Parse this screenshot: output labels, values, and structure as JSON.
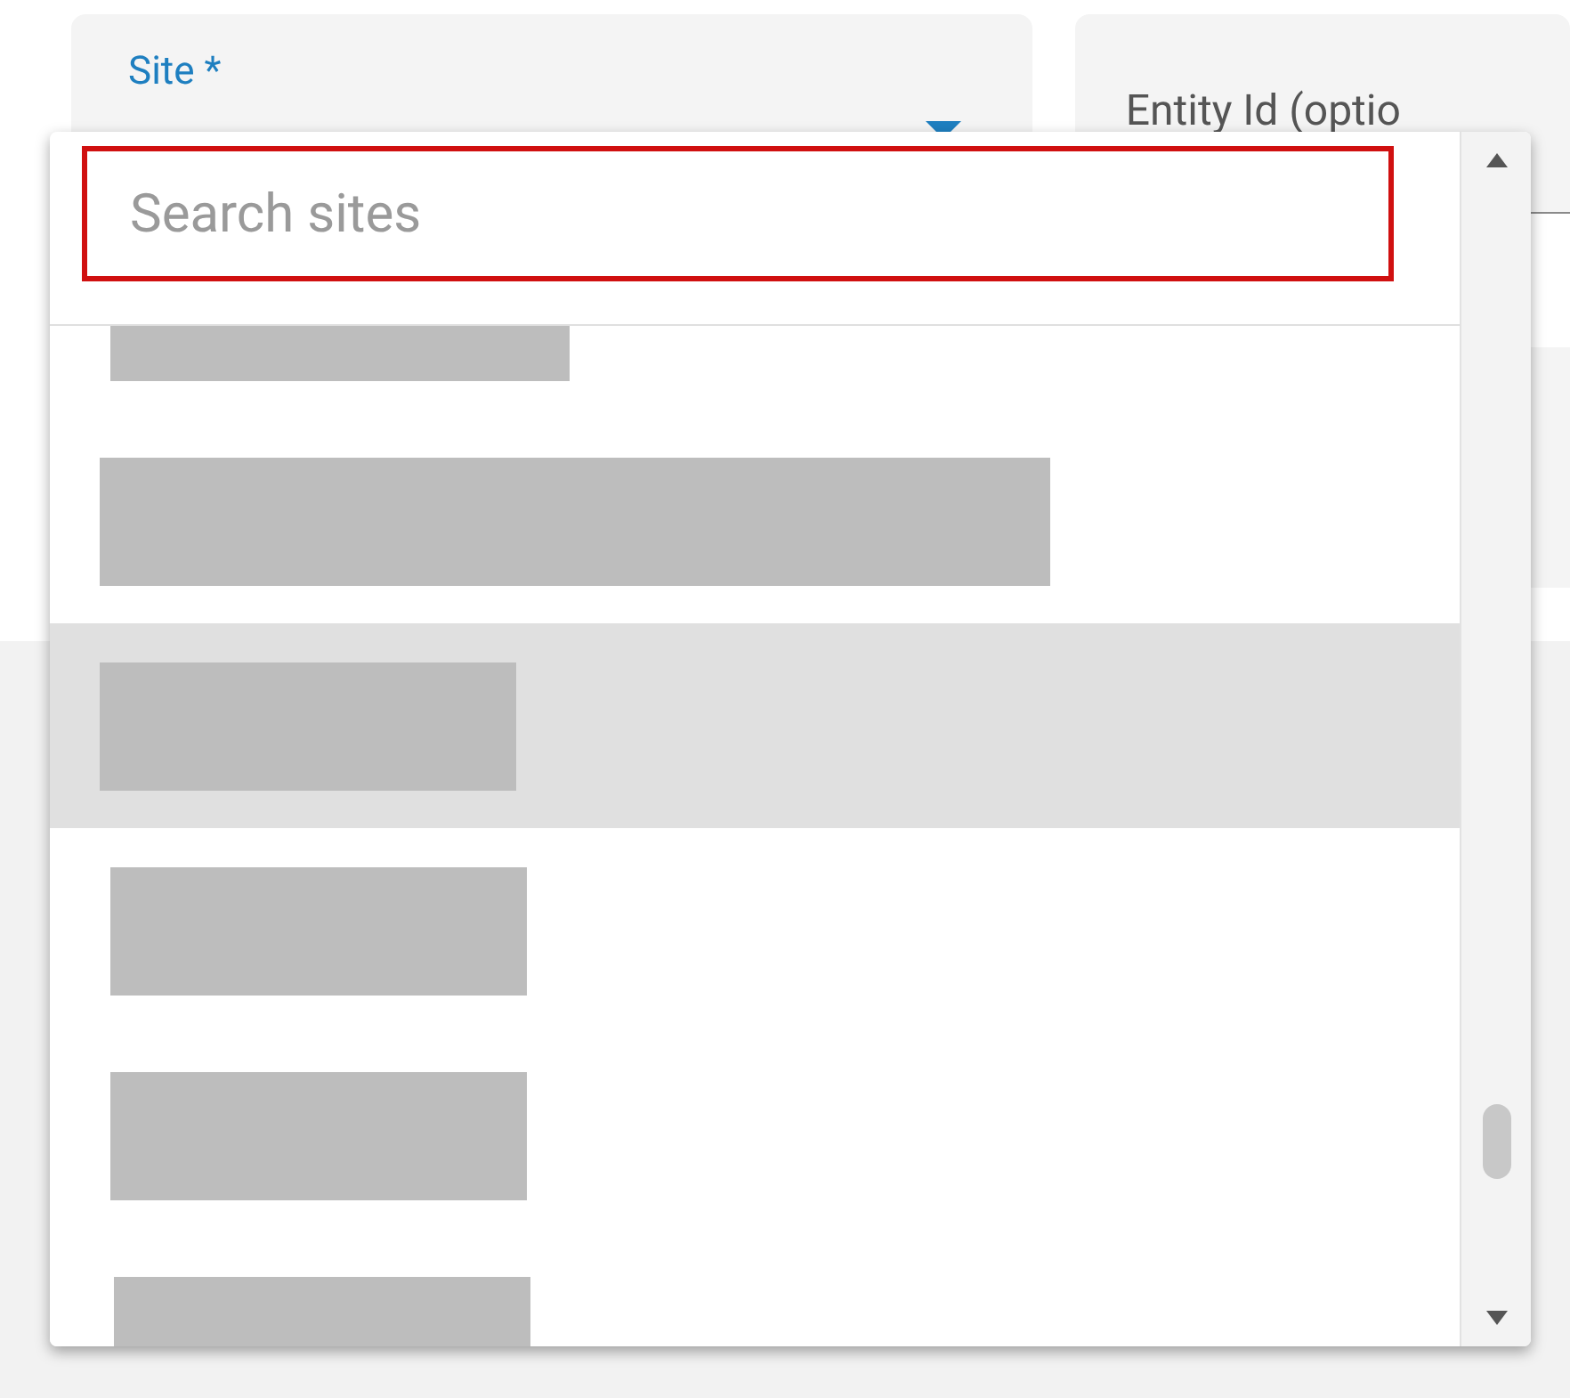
{
  "site_field": {
    "label": "Site *"
  },
  "entity_field": {
    "label": "Entity Id (optio"
  },
  "site_dropdown": {
    "search": {
      "placeholder": "Search sites"
    },
    "options": [
      {
        "highlighted": false
      },
      {
        "highlighted": false
      },
      {
        "highlighted": true
      },
      {
        "highlighted": false
      },
      {
        "highlighted": false
      },
      {
        "highlighted": false
      }
    ]
  }
}
